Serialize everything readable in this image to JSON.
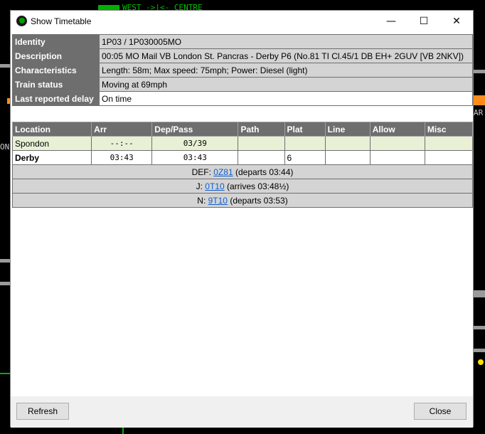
{
  "background": {
    "top_text": "WEST ->|<- CENTRE",
    "right_text": "AR",
    "left_text": "ON"
  },
  "window": {
    "title": "Show Timetable",
    "minimize_label": "—",
    "maximize_label": "☐",
    "close_label": "✕"
  },
  "info": {
    "identity_label": "Identity",
    "identity_value": "1P03 / 1P030005MO",
    "description_label": "Description",
    "description_value": "00:05 MO Mail VB London St. Pancras - Derby P6 (No.81 TI Cl.45/1 DB EH+ 2GUV [VB 2NKV])",
    "characteristics_label": "Characteristics",
    "characteristics_value": "Length: 58m; Max speed: 75mph; Power: Diesel (light)",
    "status_label": "Train status",
    "status_value": "Moving at 69mph",
    "delay_label": "Last reported delay",
    "delay_value": "On time"
  },
  "timetable": {
    "headers": [
      "Location",
      "Arr",
      "Dep/Pass",
      "Path",
      "Plat",
      "Line",
      "Allow",
      "Misc"
    ],
    "rows": [
      {
        "location": "Spondon",
        "arr": "--:--",
        "dep": "03/39",
        "path": "",
        "plat": "",
        "line": "",
        "allow": "",
        "misc": ""
      },
      {
        "location": "Derby",
        "arr": "03:43",
        "dep": "03:43",
        "path": "",
        "plat": "6",
        "line": "",
        "allow": "",
        "misc": ""
      }
    ],
    "links": [
      {
        "prefix": "DEF: ",
        "link": "0Z81",
        "suffix": " (departs 03:44)"
      },
      {
        "prefix": "J: ",
        "link": "0T10",
        "suffix": " (arrives 03:48½)"
      },
      {
        "prefix": "N: ",
        "link": "9T10",
        "suffix": " (departs 03:53)"
      }
    ]
  },
  "footer": {
    "refresh_label": "Refresh",
    "close_label": "Close"
  }
}
